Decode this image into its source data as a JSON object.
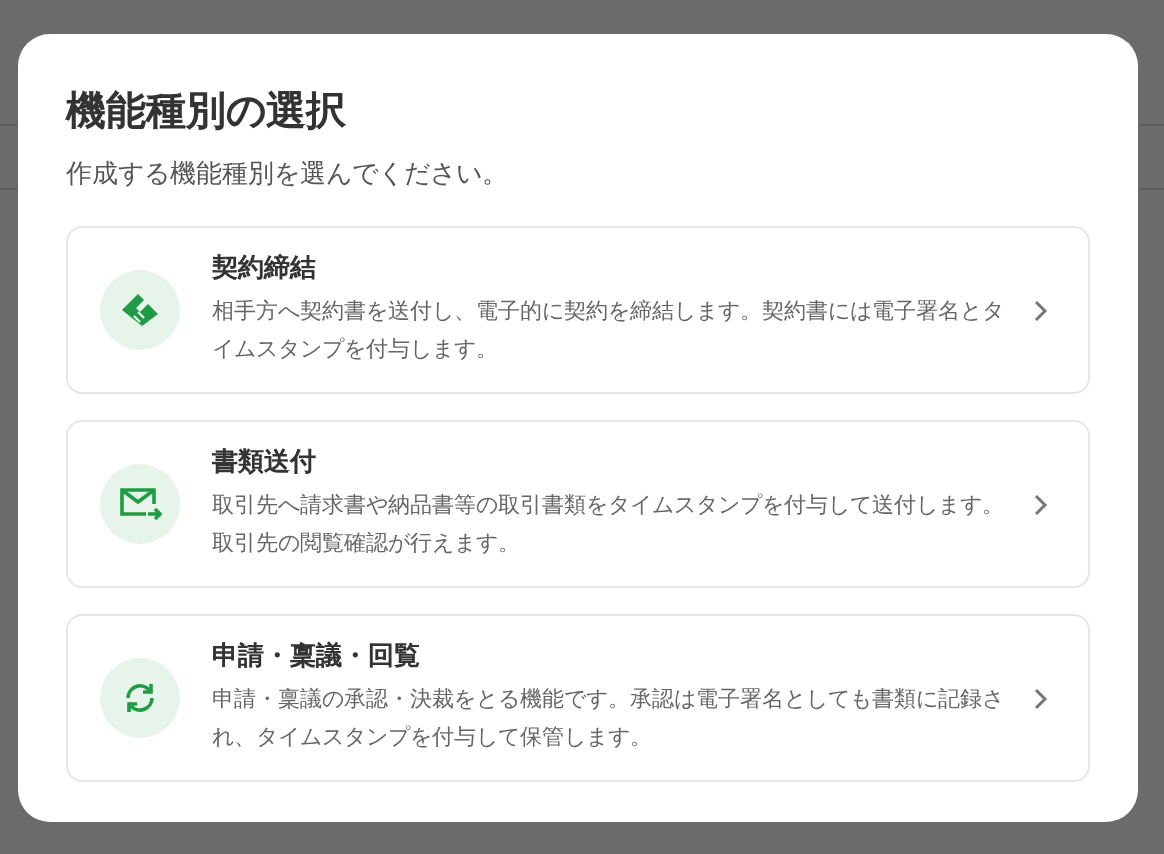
{
  "dialog": {
    "title": "機能種別の選択",
    "subtitle": "作成する機能種別を選んでください。",
    "options": [
      {
        "kind": "contract",
        "title": "契約締結",
        "description": "相手方へ契約書を送付し、電子的に契約を締結します。契約書には電子署名とタイムスタンプを付与します。"
      },
      {
        "kind": "send",
        "title": "書類送付",
        "description": "取引先へ請求書や納品書等の取引書類をタイムスタンプを付与して送付します。取引先の閲覧確認が行えます。"
      },
      {
        "kind": "workflow",
        "title": "申請・稟議・回覧",
        "description": "申請・稟議の承認・決裁をとる機能です。承認は電子署名としても書類に記録され、タイムスタンプを付与して保管します。"
      }
    ]
  }
}
